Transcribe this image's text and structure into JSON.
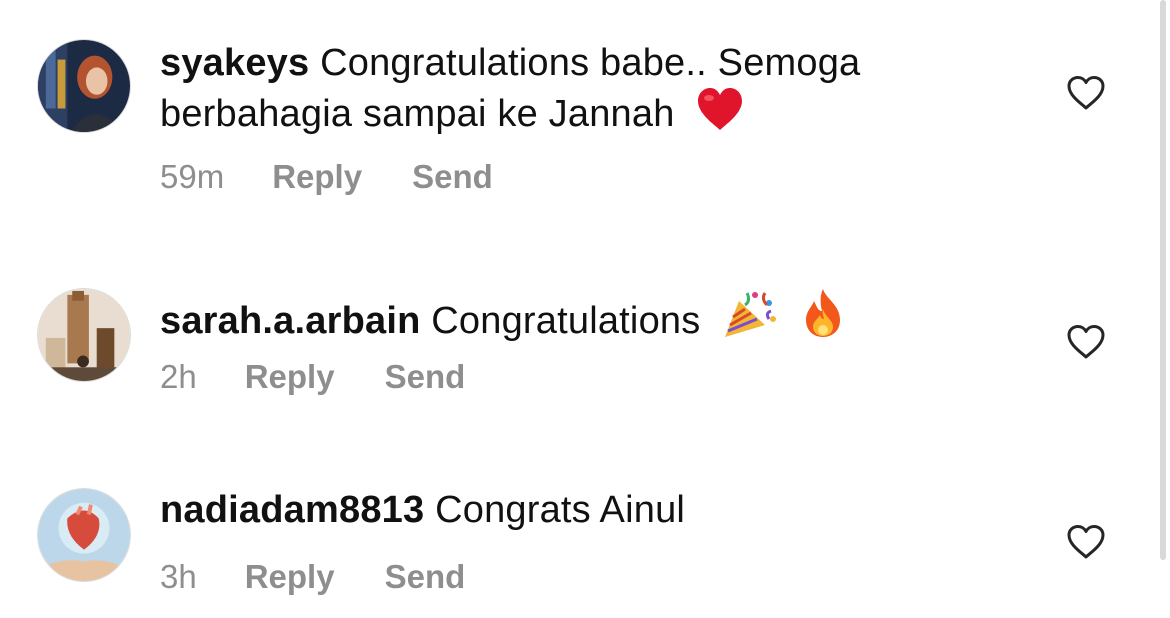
{
  "comments": [
    {
      "username": "syakeys",
      "text": "Congratulations babe.. Semoga berbahagia sampai ke Jannah",
      "emoji": "red-heart",
      "time": "59m",
      "reply_label": "Reply",
      "send_label": "Send"
    },
    {
      "username": "sarah.a.arbain",
      "text": "Congratulations",
      "emoji": "party-popper fire",
      "time": "2h",
      "reply_label": "Reply",
      "send_label": "Send"
    },
    {
      "username": "nadiadam8813",
      "text": "Congrats Ainul",
      "emoji": "",
      "time": "3h",
      "reply_label": "Reply",
      "send_label": "Send"
    }
  ],
  "colors": {
    "secondary_text": "#8e8e8e",
    "primary_text": "#111111",
    "heart_emoji": "#e0152c"
  },
  "icons": [
    "heart-outline-icon",
    "red-heart-emoji",
    "party-popper-emoji",
    "fire-emoji"
  ]
}
